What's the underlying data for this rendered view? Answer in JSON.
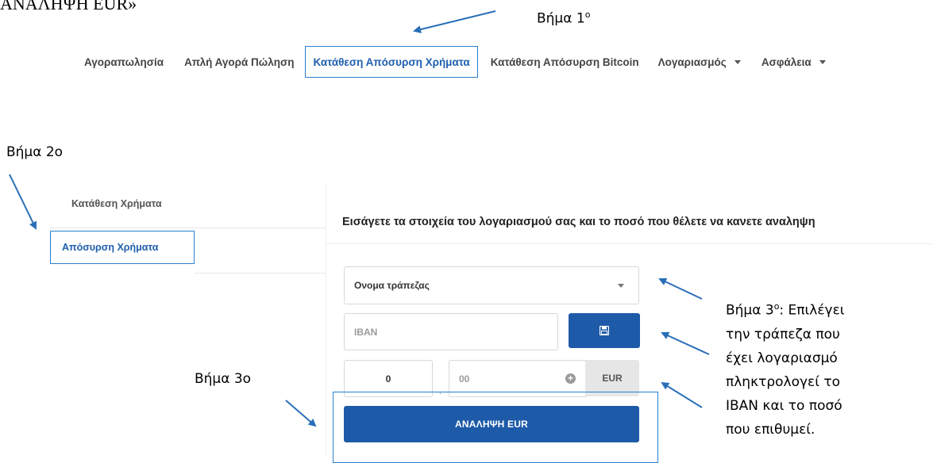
{
  "doc": {
    "heading": "ΑΝΑΛΗΨΗ EUR»",
    "step1": {
      "text": "Βήμα 1",
      "sup": "ο"
    },
    "step2": "Βήμα 2ο",
    "step3a": "Βήμα 3ο",
    "step3_lines": [
      {
        "text": "Βήμα 3",
        "sup": "ο",
        "rest": ": Επιλέγει"
      },
      {
        "text": "την τράπεζα που"
      },
      {
        "text": "έχει λογαριασμό"
      },
      {
        "text": "πληκτρολογεί το"
      },
      {
        "text": "IBAN και το ποσό"
      },
      {
        "text": "που επιθυμεί."
      }
    ]
  },
  "nav": {
    "items": [
      "Αγοραπωλησία",
      "Απλή Αγορά Πώληση",
      "Κατάθεση Απόσυρση Χρήματα",
      "Κατάθεση Απόσυρση Bitcoin",
      "Λογαριασμός",
      "Ασφάλεια"
    ]
  },
  "sidebar": {
    "deposit": "Κατάθεση Χρήματα",
    "withdraw": "Απόσυρση Χρήματα"
  },
  "form": {
    "title": "Εισάγετε τα στοιχεία του λογαριασμού σας και το ποσό που θέλετε να κανετε αναληψη",
    "bank_placeholder": "Ονομα τράπεζας",
    "iban_placeholder": "IBAN",
    "amount_whole": "0",
    "amount_decimal": "00",
    "currency": "EUR",
    "submit": "ΑΝΑΛΗΨΗ EUR"
  },
  "colors": {
    "accent": "#1d5aa8",
    "outline": "#2a7fd0"
  },
  "icons": {
    "save": "floppy-disk-icon",
    "plus": "plus-circle-icon",
    "caret": "caret-down-icon"
  }
}
